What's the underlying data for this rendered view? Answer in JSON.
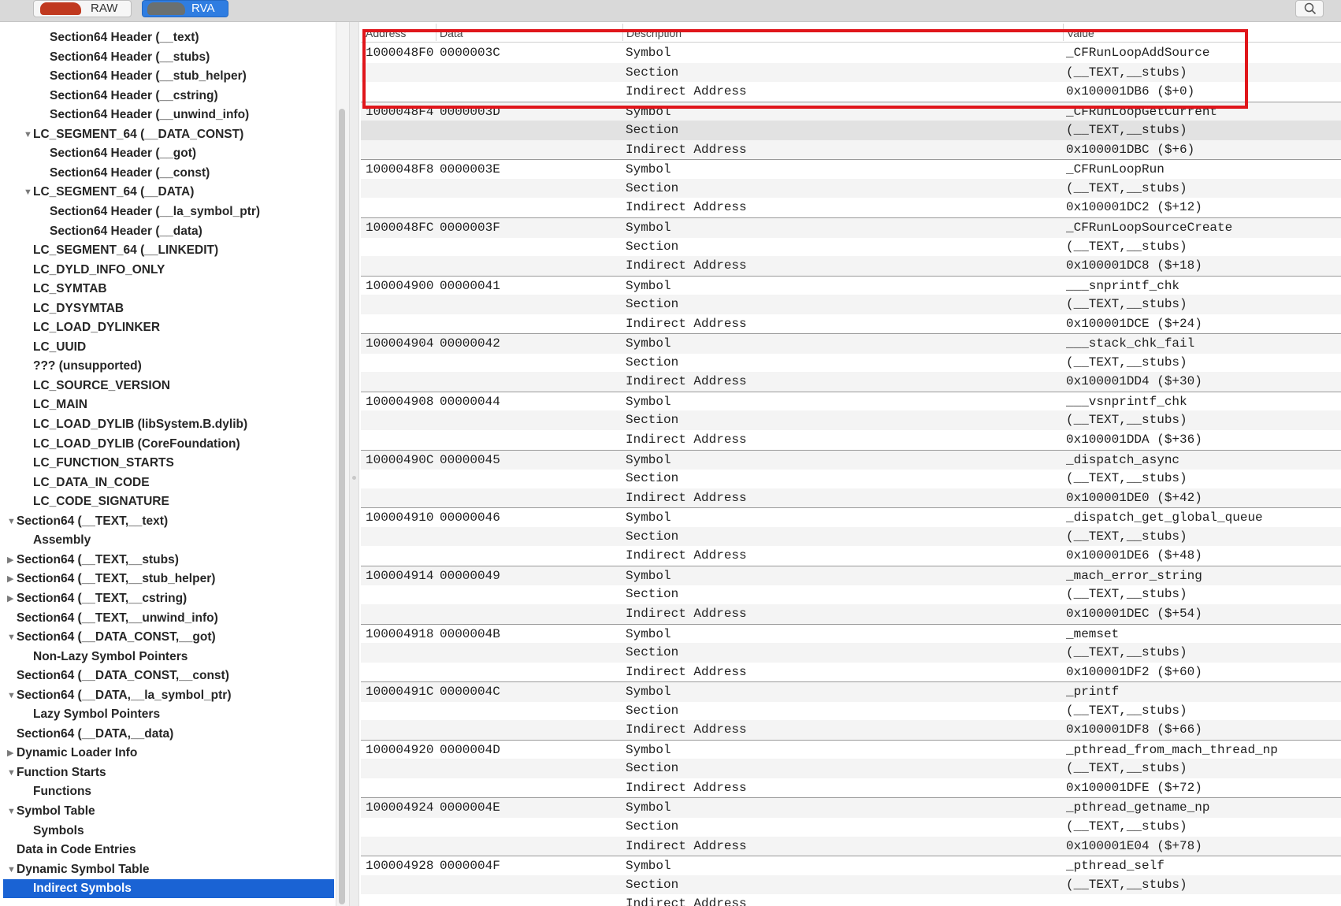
{
  "toolbar": {
    "raw_label": "RAW",
    "rva_label": "RVA",
    "selected_mode": "RVA",
    "search_icon": "magnifier-icon"
  },
  "sidebar": {
    "selected_item": "Indirect Symbols",
    "items": [
      {
        "label": "Section64 Header (__text)",
        "level": 3,
        "expander": "none"
      },
      {
        "label": "Section64 Header (__stubs)",
        "level": 3,
        "expander": "none"
      },
      {
        "label": "Section64 Header (__stub_helper)",
        "level": 3,
        "expander": "none"
      },
      {
        "label": "Section64 Header (__cstring)",
        "level": 3,
        "expander": "none"
      },
      {
        "label": "Section64 Header (__unwind_info)",
        "level": 3,
        "expander": "none"
      },
      {
        "label": "LC_SEGMENT_64 (__DATA_CONST)",
        "level": 2,
        "expander": "expanded"
      },
      {
        "label": "Section64 Header (__got)",
        "level": 3,
        "expander": "none"
      },
      {
        "label": "Section64 Header (__const)",
        "level": 3,
        "expander": "none"
      },
      {
        "label": "LC_SEGMENT_64 (__DATA)",
        "level": 2,
        "expander": "expanded"
      },
      {
        "label": "Section64 Header (__la_symbol_ptr)",
        "level": 3,
        "expander": "none"
      },
      {
        "label": "Section64 Header (__data)",
        "level": 3,
        "expander": "none"
      },
      {
        "label": "LC_SEGMENT_64 (__LINKEDIT)",
        "level": 2,
        "expander": "none"
      },
      {
        "label": "LC_DYLD_INFO_ONLY",
        "level": 2,
        "expander": "none"
      },
      {
        "label": "LC_SYMTAB",
        "level": 2,
        "expander": "none"
      },
      {
        "label": "LC_DYSYMTAB",
        "level": 2,
        "expander": "none"
      },
      {
        "label": "LC_LOAD_DYLINKER",
        "level": 2,
        "expander": "none"
      },
      {
        "label": "LC_UUID",
        "level": 2,
        "expander": "none"
      },
      {
        "label": "??? (unsupported)",
        "level": 2,
        "expander": "none"
      },
      {
        "label": "LC_SOURCE_VERSION",
        "level": 2,
        "expander": "none"
      },
      {
        "label": "LC_MAIN",
        "level": 2,
        "expander": "none"
      },
      {
        "label": "LC_LOAD_DYLIB (libSystem.B.dylib)",
        "level": 2,
        "expander": "none"
      },
      {
        "label": "LC_LOAD_DYLIB (CoreFoundation)",
        "level": 2,
        "expander": "none"
      },
      {
        "label": "LC_FUNCTION_STARTS",
        "level": 2,
        "expander": "none"
      },
      {
        "label": "LC_DATA_IN_CODE",
        "level": 2,
        "expander": "none"
      },
      {
        "label": "LC_CODE_SIGNATURE",
        "level": 2,
        "expander": "none"
      },
      {
        "label": "Section64 (__TEXT,__text)",
        "level": 1,
        "expander": "expanded"
      },
      {
        "label": "Assembly",
        "level": 2,
        "expander": "none"
      },
      {
        "label": "Section64 (__TEXT,__stubs)",
        "level": 1,
        "expander": "collapsed"
      },
      {
        "label": "Section64 (__TEXT,__stub_helper)",
        "level": 1,
        "expander": "collapsed"
      },
      {
        "label": "Section64 (__TEXT,__cstring)",
        "level": 1,
        "expander": "collapsed"
      },
      {
        "label": "Section64 (__TEXT,__unwind_info)",
        "level": 1,
        "expander": "none"
      },
      {
        "label": "Section64 (__DATA_CONST,__got)",
        "level": 1,
        "expander": "expanded"
      },
      {
        "label": "Non-Lazy Symbol Pointers",
        "level": 2,
        "expander": "none"
      },
      {
        "label": "Section64 (__DATA_CONST,__const)",
        "level": 1,
        "expander": "none"
      },
      {
        "label": "Section64 (__DATA,__la_symbol_ptr)",
        "level": 1,
        "expander": "expanded"
      },
      {
        "label": "Lazy Symbol Pointers",
        "level": 2,
        "expander": "none"
      },
      {
        "label": "Section64 (__DATA,__data)",
        "level": 1,
        "expander": "none"
      },
      {
        "label": "Dynamic Loader Info",
        "level": 1,
        "expander": "collapsed"
      },
      {
        "label": "Function Starts",
        "level": 1,
        "expander": "expanded"
      },
      {
        "label": "Functions",
        "level": 2,
        "expander": "none"
      },
      {
        "label": "Symbol Table",
        "level": 1,
        "expander": "expanded"
      },
      {
        "label": "Symbols",
        "level": 2,
        "expander": "none"
      },
      {
        "label": "Data in Code Entries",
        "level": 1,
        "expander": "none"
      },
      {
        "label": "Dynamic Symbol Table",
        "level": 1,
        "expander": "expanded"
      },
      {
        "label": "Indirect Symbols",
        "level": 2,
        "expander": "none",
        "selected": true
      }
    ]
  },
  "table": {
    "columns": [
      "Address",
      "Data",
      "Description",
      "Value"
    ],
    "highlighted_entry_index": 0,
    "highlight_color": "#e0161b",
    "entries": [
      {
        "address": "1000048F0",
        "data": "0000003C",
        "symbol": "_CFRunLoopAddSource",
        "section": "(__TEXT,__stubs)",
        "indirect": "0x100001DB6 ($+0)"
      },
      {
        "address": "1000048F4",
        "data": "0000003D",
        "symbol": "_CFRunLoopGetCurrent",
        "section": "(__TEXT,__stubs)",
        "indirect": "0x100001DBC ($+6)"
      },
      {
        "address": "1000048F8",
        "data": "0000003E",
        "symbol": "_CFRunLoopRun",
        "section": "(__TEXT,__stubs)",
        "indirect": "0x100001DC2 ($+12)"
      },
      {
        "address": "1000048FC",
        "data": "0000003F",
        "symbol": "_CFRunLoopSourceCreate",
        "section": "(__TEXT,__stubs)",
        "indirect": "0x100001DC8 ($+18)"
      },
      {
        "address": "100004900",
        "data": "00000041",
        "symbol": "___snprintf_chk",
        "section": "(__TEXT,__stubs)",
        "indirect": "0x100001DCE ($+24)"
      },
      {
        "address": "100004904",
        "data": "00000042",
        "symbol": "___stack_chk_fail",
        "section": "(__TEXT,__stubs)",
        "indirect": "0x100001DD4 ($+30)"
      },
      {
        "address": "100004908",
        "data": "00000044",
        "symbol": "___vsnprintf_chk",
        "section": "(__TEXT,__stubs)",
        "indirect": "0x100001DDA ($+36)"
      },
      {
        "address": "10000490C",
        "data": "00000045",
        "symbol": "_dispatch_async",
        "section": "(__TEXT,__stubs)",
        "indirect": "0x100001DE0 ($+42)"
      },
      {
        "address": "100004910",
        "data": "00000046",
        "symbol": "_dispatch_get_global_queue",
        "section": "(__TEXT,__stubs)",
        "indirect": "0x100001DE6 ($+48)"
      },
      {
        "address": "100004914",
        "data": "00000049",
        "symbol": "_mach_error_string",
        "section": "(__TEXT,__stubs)",
        "indirect": "0x100001DEC ($+54)"
      },
      {
        "address": "100004918",
        "data": "0000004B",
        "symbol": "_memset",
        "section": "(__TEXT,__stubs)",
        "indirect": "0x100001DF2 ($+60)"
      },
      {
        "address": "10000491C",
        "data": "0000004C",
        "symbol": "_printf",
        "section": "(__TEXT,__stubs)",
        "indirect": "0x100001DF8 ($+66)"
      },
      {
        "address": "100004920",
        "data": "0000004D",
        "symbol": "_pthread_from_mach_thread_np",
        "section": "(__TEXT,__stubs)",
        "indirect": "0x100001DFE ($+72)"
      },
      {
        "address": "100004924",
        "data": "0000004E",
        "symbol": "_pthread_getname_np",
        "section": "(__TEXT,__stubs)",
        "indirect": "0x100001E04 ($+78)"
      },
      {
        "address": "100004928",
        "data": "0000004F",
        "symbol": "_pthread_self",
        "section": "(__TEXT,__stubs)",
        "indirect": ""
      }
    ],
    "desc_symbol": "Symbol",
    "desc_section": "Section",
    "desc_indirect": "Indirect Address"
  }
}
